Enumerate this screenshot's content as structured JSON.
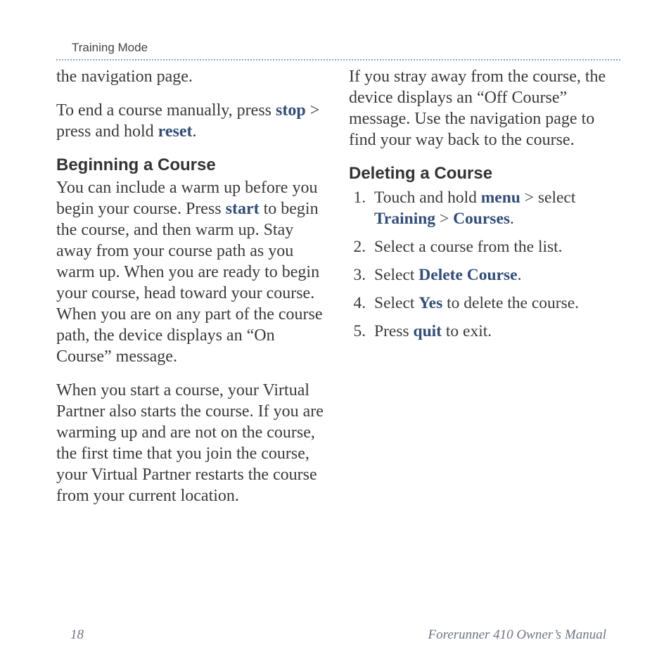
{
  "header": {
    "section_label": "Training Mode"
  },
  "left": {
    "p1_a": "the navigation page.",
    "p2_a": "To end a course manually, press ",
    "p2_kw1": "stop",
    "p2_b": " > press and hold ",
    "p2_kw2": "reset",
    "p2_c": ".",
    "h1": "Beginning a Course",
    "p3_a": "You can include a warm up before you begin your course. Press ",
    "p3_kw1": "start",
    "p3_b": " to begin the course, and then warm up. Stay away from your course path as you warm up. When you are ready to begin your course, head toward your course. When you are on any part of the course path, the device displays an “On Course” message.",
    "p4": "When you start a course, your Virtual Partner also starts the course. If you are warming up and are not on the course, the first time that you join the course, your Virtual Partner restarts the course from your current location."
  },
  "right": {
    "p1": "If you stray away from the course, the device displays an “Off Course” message. Use the navigation page to find your way back to the course.",
    "h1": "Deleting a Course",
    "li1_a": "Touch and hold ",
    "li1_kw1": "menu",
    "li1_b": " > select ",
    "li1_kw2": "Training",
    "li1_c": " > ",
    "li1_kw3": "Courses",
    "li1_d": ".",
    "li2": "Select a course from the list.",
    "li3_a": "Select ",
    "li3_kw1": "Delete Course",
    "li3_b": ".",
    "li4_a": "Select ",
    "li4_kw1": "Yes",
    "li4_b": " to delete the course.",
    "li5_a": "Press ",
    "li5_kw1": "quit",
    "li5_b": " to exit."
  },
  "footer": {
    "page_number": "18",
    "doc_title": "Forerunner 410 Owner’s Manual"
  }
}
